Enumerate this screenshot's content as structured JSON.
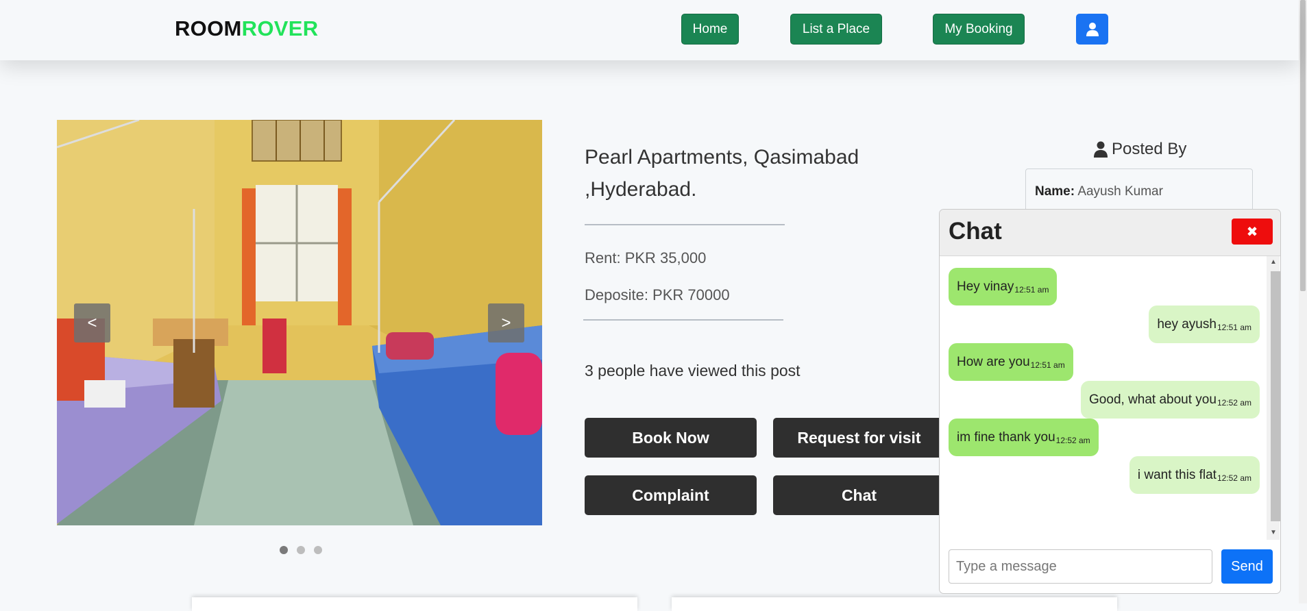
{
  "brand": {
    "part1": "ROOM",
    "part2": "ROVER"
  },
  "nav": {
    "home": "Home",
    "list_place": "List a Place",
    "my_booking": "My Booking"
  },
  "carousel": {
    "prev": "<",
    "next": ">"
  },
  "property": {
    "title": "Pearl Apartments, Qasimabad ,Hyderabad.",
    "rent": "Rent: PKR 35,000",
    "deposit": "Deposite: PKR 70000",
    "views": "3 people have viewed this post"
  },
  "actions": {
    "book_now": "Book Now",
    "request_visit": "Request for visit",
    "complaint": "Complaint",
    "chat": "Chat"
  },
  "posted_by": {
    "heading": "Posted By",
    "name_label": "Name:",
    "name_value": "Aayush Kumar"
  },
  "chat": {
    "title": "Chat",
    "close": "✖",
    "messages": [
      {
        "text": "Hey vinay",
        "time": "12:51 am",
        "dir": "in"
      },
      {
        "text": "hey ayush",
        "time": "12:51 am",
        "dir": "out"
      },
      {
        "text": "How are you",
        "time": "12:51 am",
        "dir": "in"
      },
      {
        "text": "Good, what about you",
        "time": "12:52 am",
        "dir": "out"
      },
      {
        "text": "im fine thank you",
        "time": "12:52 am",
        "dir": "in"
      },
      {
        "text": "i want this flat",
        "time": "12:52 am",
        "dir": "out"
      }
    ],
    "input_placeholder": "Type a message",
    "input_value": "",
    "send": "Send"
  },
  "colors": {
    "nav_green": "#1b8553",
    "brand_green": "#22e35a",
    "user_blue": "#1a73f2",
    "action_dark": "#2f2f2f",
    "close_red": "#ee0d0d",
    "msg_in": "#9de66e",
    "msg_out": "#d9f5c6",
    "send_blue": "#0d72f7"
  }
}
